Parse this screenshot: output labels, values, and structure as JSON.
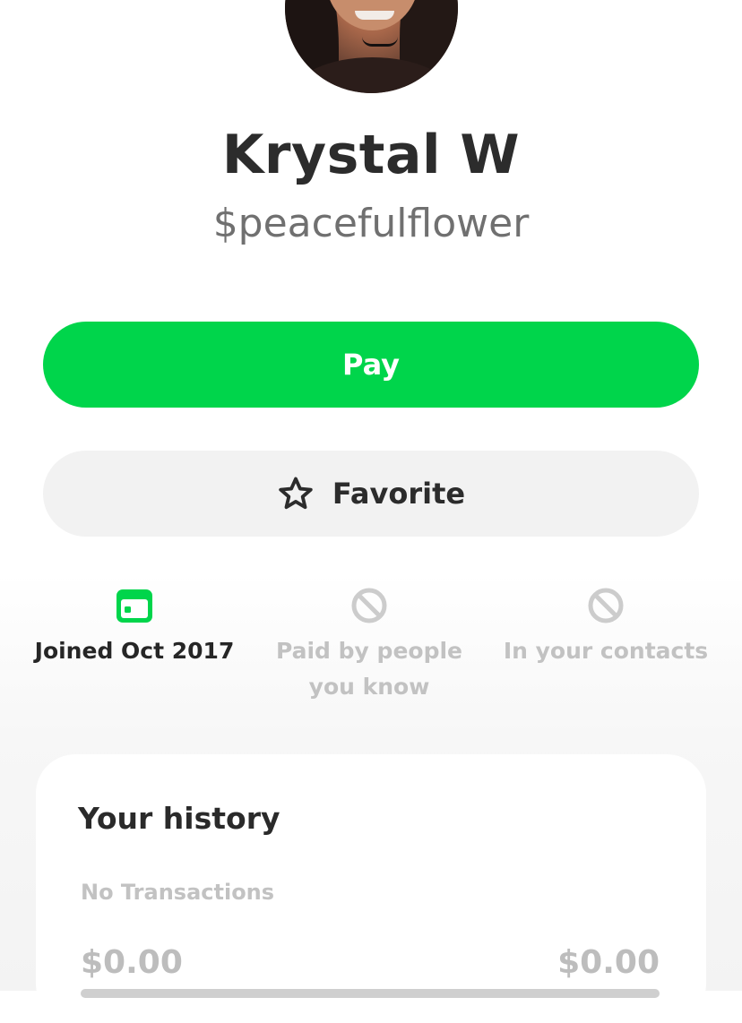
{
  "profile": {
    "name": "Krystal W",
    "cashtag": "$peacefulflower",
    "avatar_icon": "profile-photo"
  },
  "actions": {
    "pay_label": "Pay",
    "favorite_label": "Favorite",
    "favorite_icon": "star-outline-icon"
  },
  "badges": [
    {
      "label": "Joined Oct 2017",
      "icon": "calendar-icon",
      "active": true
    },
    {
      "label": "Paid by people you know",
      "icon": "blocked-icon",
      "active": false
    },
    {
      "label": "In your contacts",
      "icon": "blocked-icon",
      "active": false
    }
  ],
  "history": {
    "title": "Your history",
    "empty_text": "No Transactions",
    "amount_left": "$0.00",
    "amount_right": "$0.00"
  },
  "colors": {
    "brand_green": "#00d54b",
    "secondary_button": "#f2f2f2",
    "muted_text": "#c2c2c2"
  }
}
